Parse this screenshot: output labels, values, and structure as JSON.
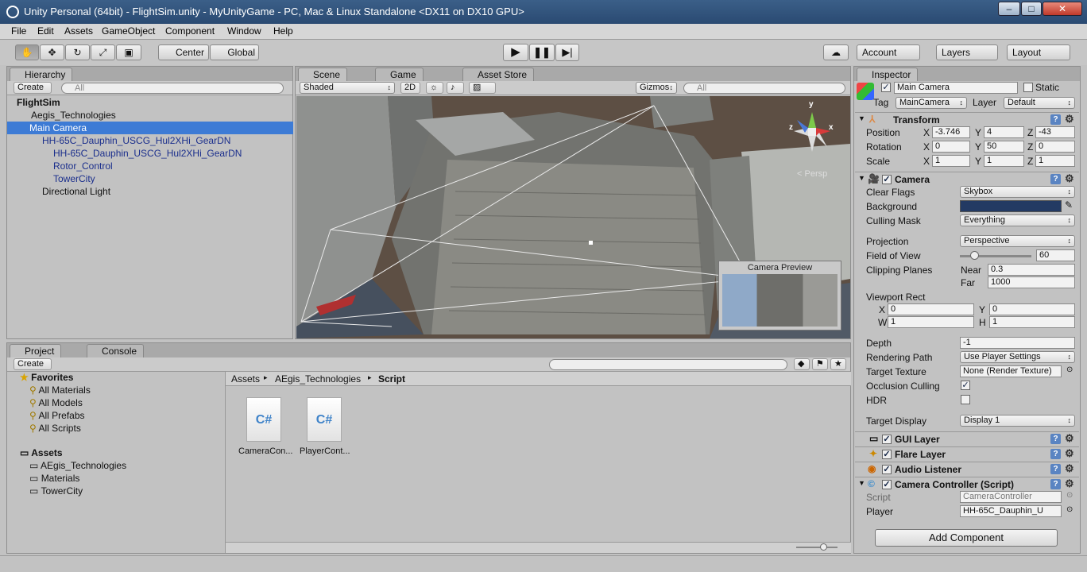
{
  "window": {
    "title": "Unity Personal (64bit) - FlightSim.unity - MyUnityGame - PC, Mac & Linux Standalone <DX11 on DX10 GPU>",
    "min": "–",
    "max": "□",
    "close": "✕"
  },
  "menu": [
    "File",
    "Edit",
    "Assets",
    "GameObject",
    "Component",
    "Window",
    "Help"
  ],
  "toolbar": {
    "pivot": "Center",
    "space": "Global",
    "account": "Account",
    "layers": "Layers",
    "layout": "Layout"
  },
  "hierarchy": {
    "tab": "Hierarchy",
    "create": "Create",
    "search": "All",
    "scene": "FlightSim",
    "items": [
      "Aegis_Technologies",
      "Main Camera",
      "HH-65C_Dauphin_USCG_Hul2XHi_GearDN",
      "HH-65C_Dauphin_USCG_Hul2XHi_GearDN",
      "Rotor_Control",
      "TowerCity",
      "Directional Light"
    ]
  },
  "scene": {
    "tabs": [
      "Scene",
      "Game",
      "Asset Store"
    ],
    "shading": "Shaded",
    "mode2d": "2D",
    "gizmos": "Gizmos",
    "search": "All",
    "persp": "Persp",
    "preview": "Camera Preview",
    "axis_y": "y",
    "axis_x": "x",
    "axis_z": "z"
  },
  "project": {
    "tabs": [
      "Project",
      "Console"
    ],
    "create": "Create",
    "favorites": "Favorites",
    "fav_items": [
      "All Materials",
      "All Models",
      "All Prefabs",
      "All Scripts"
    ],
    "assets": "Assets",
    "asset_items": [
      "AEgis_Technologies",
      "Materials",
      "TowerCity"
    ],
    "breadcrumb": [
      "Assets",
      "AEgis_Technologies",
      "Script"
    ],
    "files": [
      "CameraCon...",
      "PlayerCont..."
    ],
    "file_glyph": "C#"
  },
  "inspector": {
    "tab": "Inspector",
    "name": "Main Camera",
    "static": "Static",
    "tag_label": "Tag",
    "tag": "MainCamera",
    "layer_label": "Layer",
    "layer": "Default",
    "transform": {
      "title": "Transform",
      "position": "Position",
      "rotation": "Rotation",
      "scale": "Scale",
      "pos": [
        "-3.746",
        "4",
        "-43"
      ],
      "rot": [
        "0",
        "50",
        "0"
      ],
      "scl": [
        "1",
        "1",
        "1"
      ],
      "x": "X",
      "y": "Y",
      "z": "Z"
    },
    "camera": {
      "title": "Camera",
      "clear_flags": "Clear Flags",
      "clear_flags_v": "Skybox",
      "background": "Background",
      "culling": "Culling Mask",
      "culling_v": "Everything",
      "projection": "Projection",
      "projection_v": "Perspective",
      "fov": "Field of View",
      "fov_v": "60",
      "fov_level": 0.2,
      "clipping": "Clipping Planes",
      "near": "Near",
      "near_v": "0.3",
      "far": "Far",
      "far_v": "1000",
      "viewport": "Viewport Rect",
      "vx": "X",
      "vy": "Y",
      "vw": "W",
      "vh": "H",
      "vx_v": "0",
      "vy_v": "0",
      "vw_v": "1",
      "vh_v": "1",
      "depth": "Depth",
      "depth_v": "-1",
      "rpath": "Rendering Path",
      "rpath_v": "Use Player Settings",
      "ttex": "Target Texture",
      "ttex_v": "None (Render Texture)",
      "occ": "Occlusion Culling",
      "hdr": "HDR",
      "tdisp": "Target Display",
      "tdisp_v": "Display 1"
    },
    "gui_layer": "GUI Layer",
    "flare_layer": "Flare Layer",
    "audio_listener": "Audio Listener",
    "script": {
      "title": "Camera Controller (Script)",
      "script_label": "Script",
      "script_v": "CameraController",
      "player_label": "Player",
      "player_v": "HH-65C_Dauphin_U"
    },
    "add_component": "Add Component"
  },
  "colors": {
    "accent": "#3d7bd5",
    "background_swatch": "#233a63"
  }
}
